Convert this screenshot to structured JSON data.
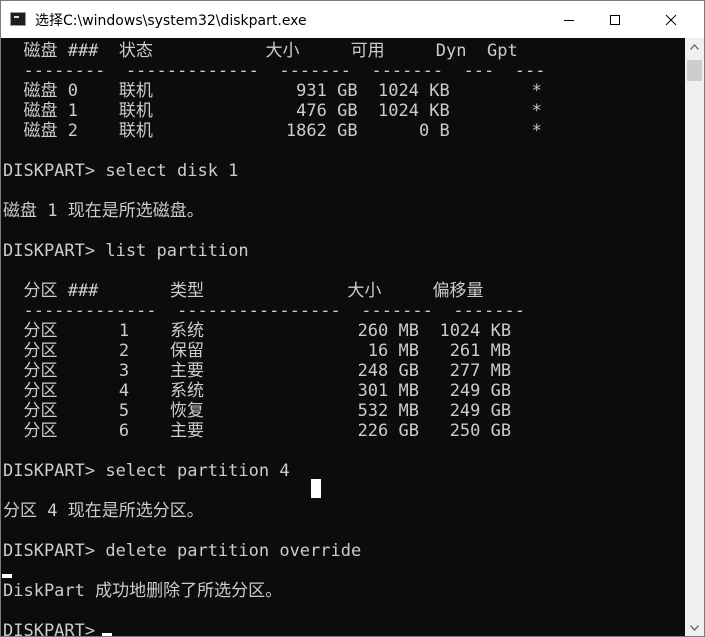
{
  "window": {
    "title": "选择C:\\windows\\system32\\diskpart.exe",
    "icon": "console-icon"
  },
  "controls": {
    "minimize": "minimize-icon",
    "maximize": "maximize-icon",
    "close": "close-icon"
  },
  "console": {
    "lines": [
      "  磁盘 ###  状态           大小     可用     Dyn  Gpt",
      "  --------  -------------  -------  -------  ---  ---",
      "  磁盘 0    联机              931 GB  1024 KB        *",
      "  磁盘 1    联机              476 GB  1024 KB        *",
      "  磁盘 2    联机             1862 GB      0 B        *",
      "",
      "DISKPART> select disk 1",
      "",
      "磁盘 1 现在是所选磁盘。",
      "",
      "DISKPART> list partition",
      "",
      "  分区 ###       类型              大小     偏移量",
      "  -------------  ----------------  -------  -------",
      "  分区      1    系统               260 MB  1024 KB",
      "  分区      2    保留                16 MB   261 MB",
      "  分区      3    主要               248 GB   277 MB",
      "  分区      4    系统               301 MB   249 GB",
      "  分区      5    恢复               532 MB   249 GB",
      "  分区      6    主要               226 GB   250 GB",
      "",
      "DISKPART> select partition 4",
      "",
      "分区 4 现在是所选分区。",
      "",
      "DISKPART> delete partition override",
      "",
      "DiskPart 成功地删除了所选分区。",
      "",
      "DISKPART> "
    ]
  },
  "colors": {
    "console_bg": "#0c0c0c",
    "console_text": "#cccccc",
    "titlebar_bg": "#ffffff"
  }
}
